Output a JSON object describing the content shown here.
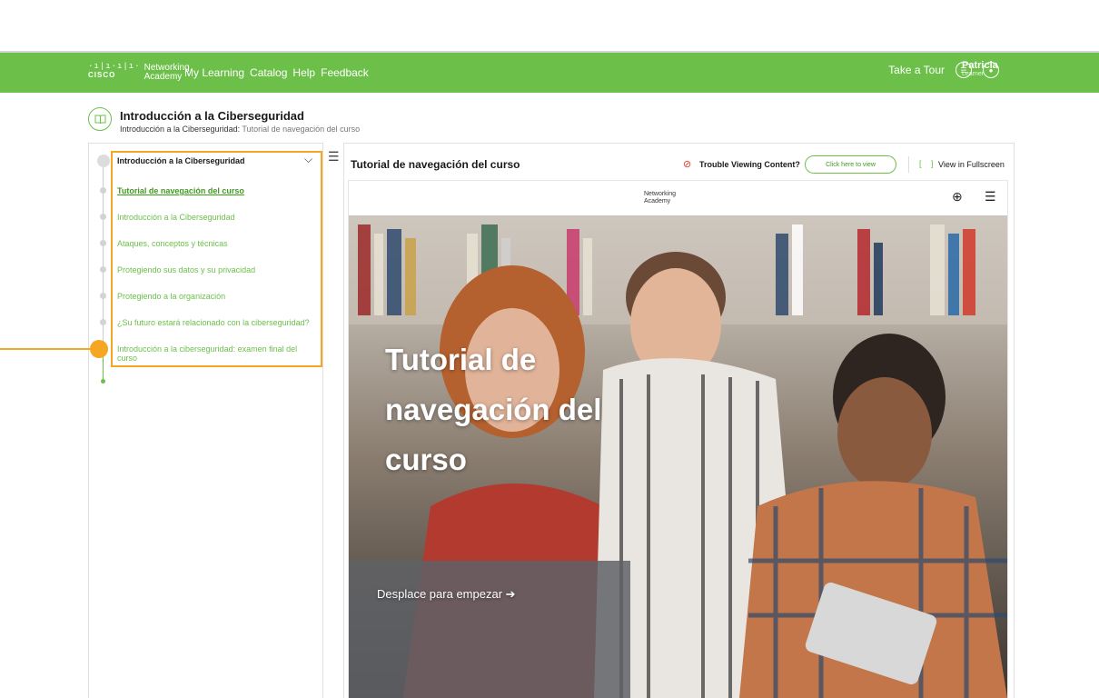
{
  "topbar": {
    "brand_marks": "·ı|ı·ı|ı·",
    "brand_word": "CISCO",
    "brand_line1": "Networking",
    "brand_line2": "Academy",
    "nav": [
      "My Learning",
      "Catalog",
      "Help",
      "Feedback"
    ],
    "tour": "Take a Tour",
    "user_name": "Patricia",
    "user_role": "Learner",
    "accent_color": "#6cc04a"
  },
  "course": {
    "title": "Introducción a la Ciberseguridad",
    "crumb_1": "Introducción a la Ciberseguridad:",
    "crumb_2": "Tutorial de navegación del curso"
  },
  "sidebar": {
    "module_title": "Introducción a la Ciberseguridad",
    "items": [
      "Tutorial de navegación del curso",
      "Introducción a la Ciberseguridad",
      "Ataques, conceptos y técnicas",
      "Protegiendo sus datos y su privacidad",
      "Protegiendo a la organización",
      "¿Su futuro estará relacionado con la ciberseguridad?",
      "Introducción a la ciberseguridad: examen final del curso"
    ],
    "highlight_color": "#f5a623"
  },
  "content": {
    "title": "Tutorial de navegación del curso",
    "trouble": "Trouble Viewing Content?",
    "click_button": "Click here to view",
    "fullscreen": "View in Fullscreen",
    "inner_logo_line1": "Networking",
    "inner_logo_line2": "Academy",
    "hero_title_1": "Tutorial de",
    "hero_title_2": "navegación del",
    "hero_title_3": "curso",
    "scroll_hint": "Desplace para empezar ➔"
  }
}
